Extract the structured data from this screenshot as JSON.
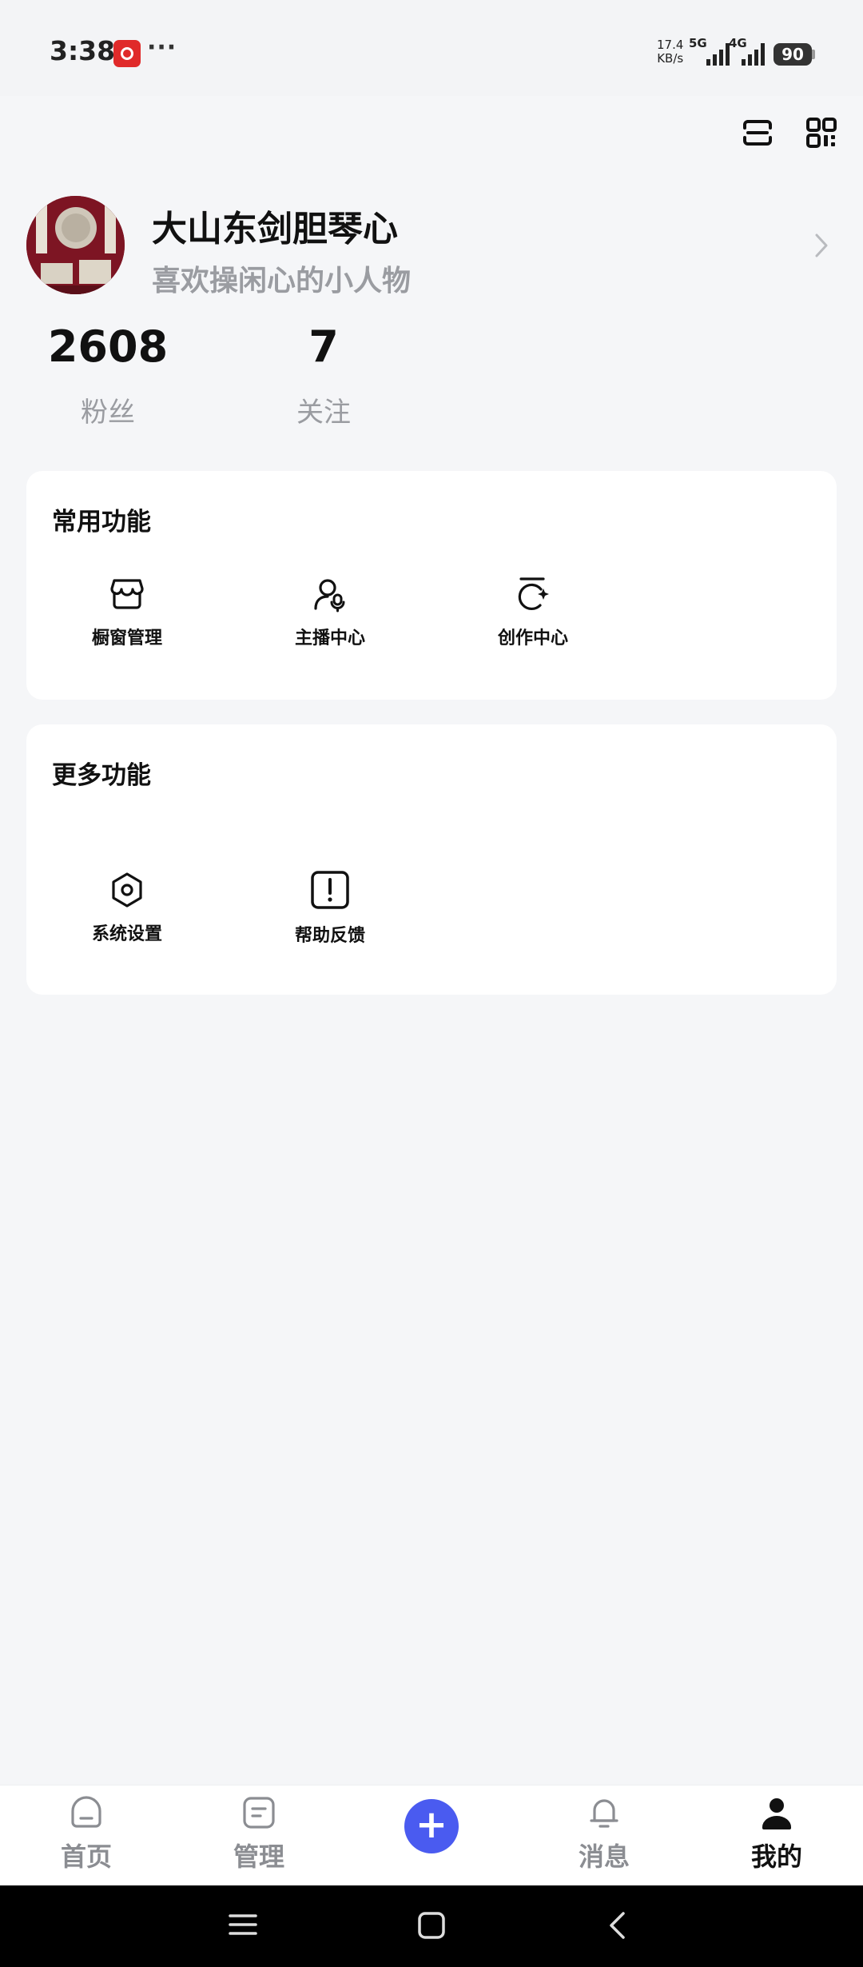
{
  "status_bar": {
    "time": "3:38",
    "net_speed_value": "17.4",
    "net_speed_unit": "KB/s",
    "network_1": "5G",
    "network_2": "4G",
    "battery": "90"
  },
  "profile": {
    "nickname": "大山东剑胆琴心",
    "bio": "喜欢操闲心的小人物",
    "followers_count": "2608",
    "followers_label": "粉丝",
    "following_count": "7",
    "following_label": "关注"
  },
  "common_functions": {
    "title": "常用功能",
    "items": [
      {
        "label": "橱窗管理",
        "icon": "storefront-icon"
      },
      {
        "label": "主播中心",
        "icon": "anchor-mic-icon"
      },
      {
        "label": "创作中心",
        "icon": "creation-sparkle-icon"
      }
    ]
  },
  "more_functions": {
    "title": "更多功能",
    "items": [
      {
        "label": "系统设置",
        "icon": "hexagon-settings-icon"
      },
      {
        "label": "帮助反馈",
        "icon": "exclamation-feedback-icon"
      }
    ]
  },
  "tab_bar": {
    "items": [
      {
        "label": "首页",
        "icon": "home-icon",
        "active": false
      },
      {
        "label": "管理",
        "icon": "manage-icon",
        "active": false
      },
      {
        "label": "消息",
        "icon": "bell-icon",
        "active": false
      },
      {
        "label": "我的",
        "icon": "user-icon",
        "active": true
      }
    ],
    "plus_symbol": "+"
  },
  "colors": {
    "accent": "#4a5bf0",
    "background": "#f5f6f8",
    "muted_text": "#9a9ca1"
  }
}
